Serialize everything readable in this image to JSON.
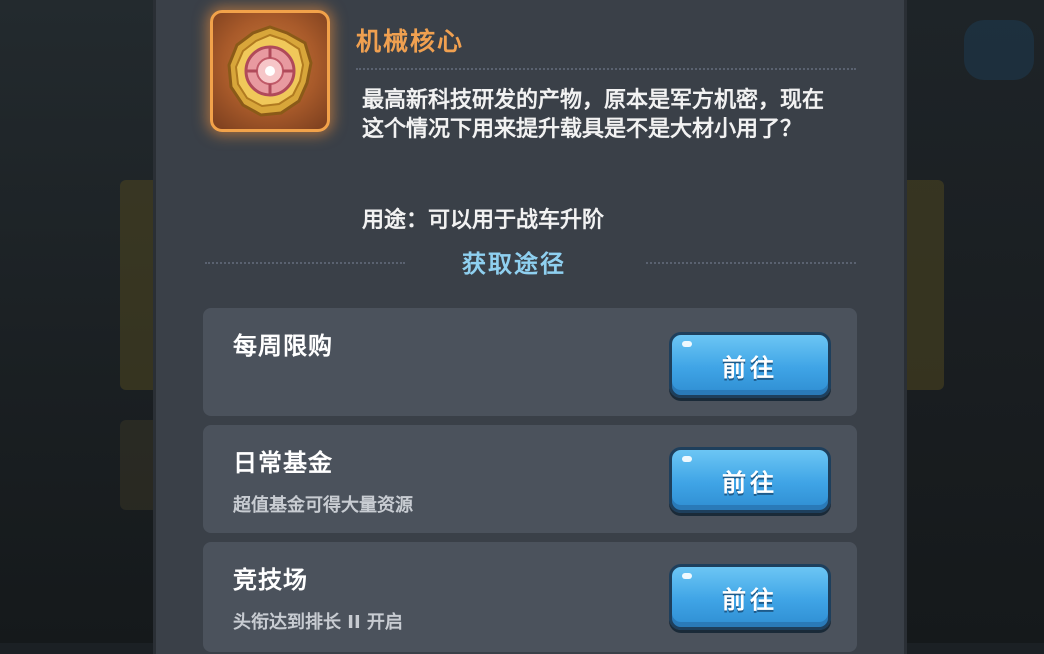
{
  "item": {
    "name": "机械核心",
    "description": "最高新科技研发的产物，原本是军方机密，现在这个情况下用来提升载具是不是大材小用了？",
    "usage": "用途：可以用于战车升阶",
    "icon": "mechanical-core-icon"
  },
  "sources": {
    "title": "获取途径",
    "items": [
      {
        "label": "每周限购",
        "subtitle": "",
        "button": "前往"
      },
      {
        "label": "日常基金",
        "subtitle": "超值基金可得大量资源",
        "button": "前往"
      },
      {
        "label": "竞技场",
        "subtitle": "头衔达到排长 II 开启",
        "button": "前往"
      }
    ]
  },
  "colors": {
    "item_name": "#f0a050",
    "section_title": "#8fd0f0",
    "button": "#3fa4e6",
    "panel": "#3a4048",
    "row": "#4b525c"
  }
}
